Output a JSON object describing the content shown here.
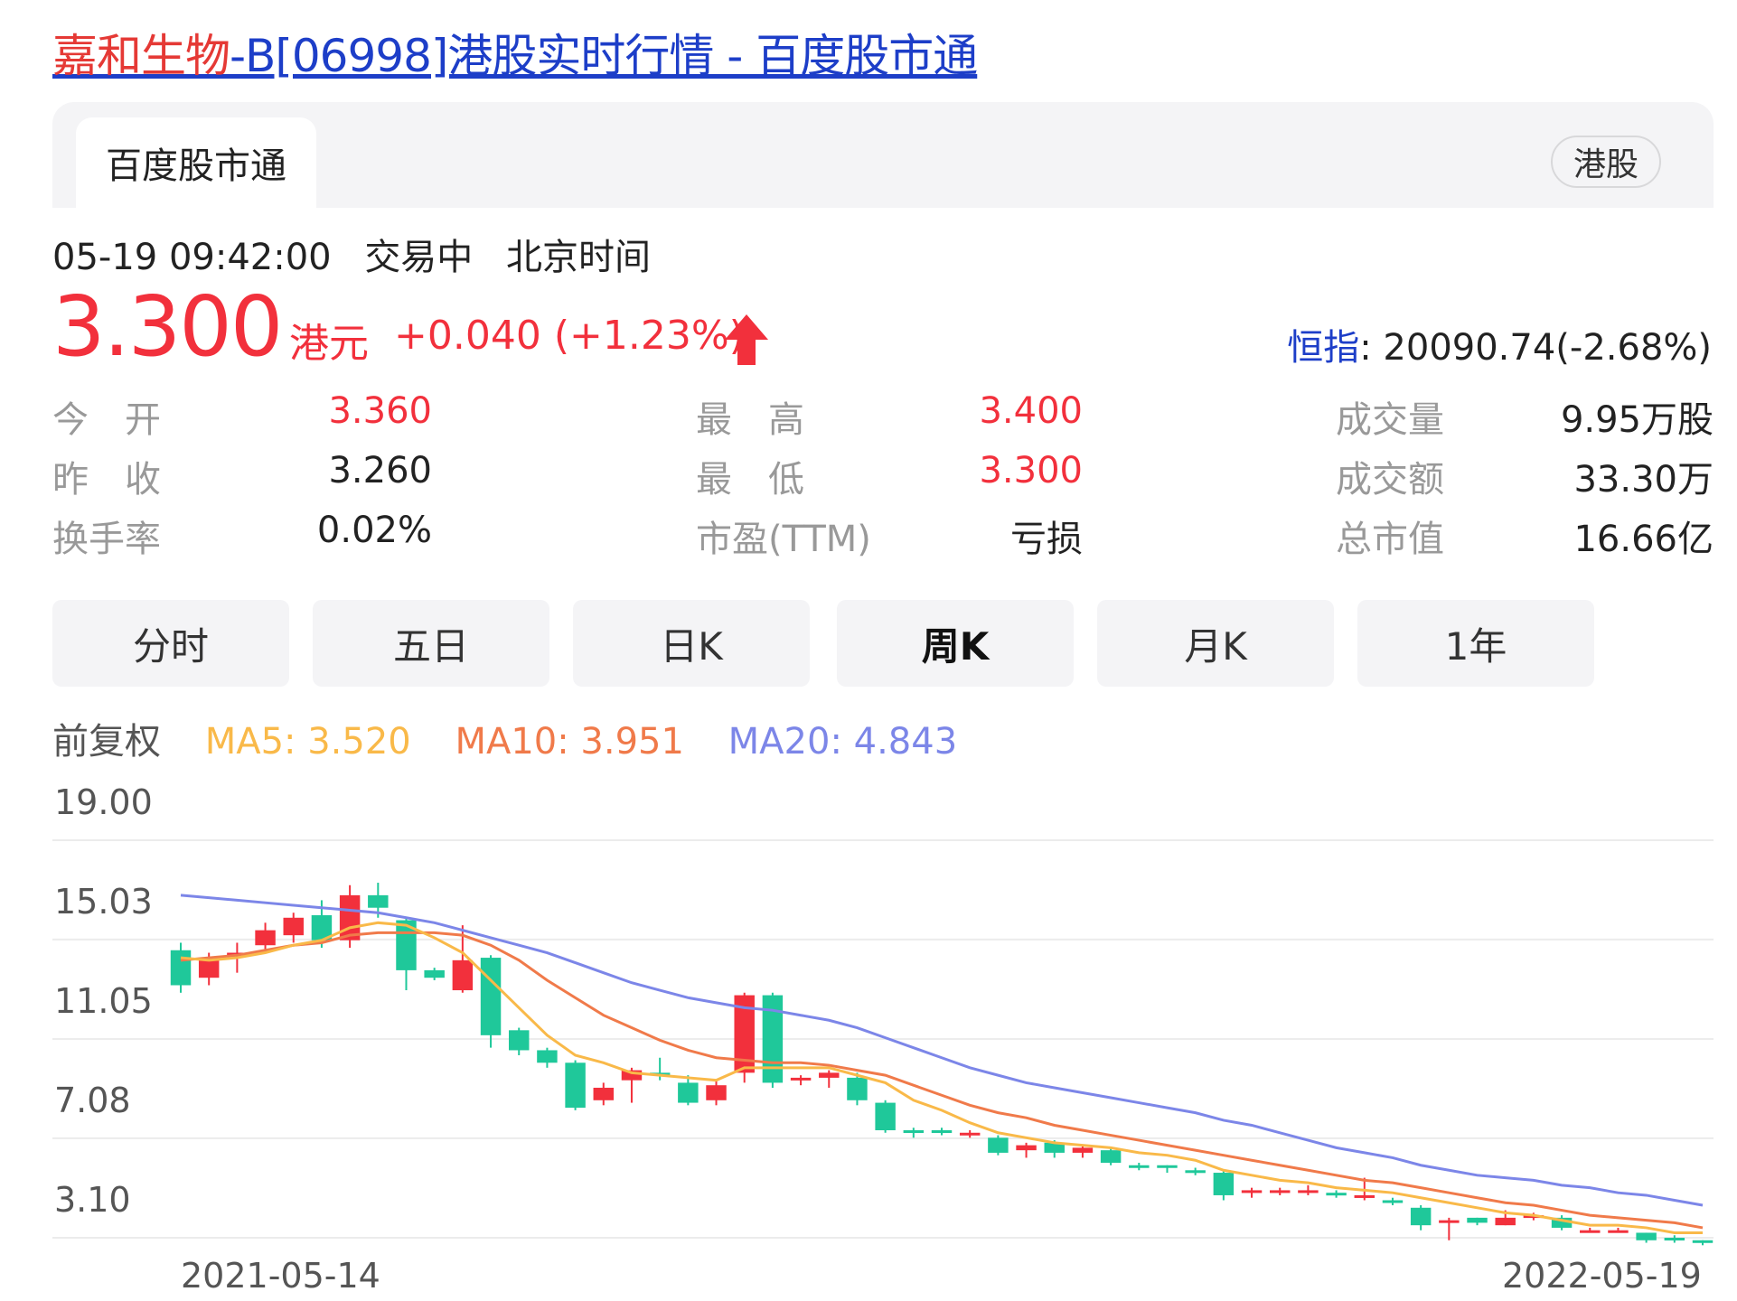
{
  "header": {
    "title_name": "嘉和生物",
    "title_rest": "-B[06998]港股实时行情 - 百度股市通"
  },
  "tabs": {
    "active_label": "百度股市通",
    "market_tag": "港股"
  },
  "status": {
    "datetime": "05-19 09:42:00",
    "trading_state": "交易中",
    "timezone": "北京时间"
  },
  "quote": {
    "price": "3.300",
    "currency": "港元",
    "change": "+0.040 (+1.23%)",
    "index_label": "恒指",
    "index_value": ": 20090.74(-2.68%)"
  },
  "stats": {
    "open_label": "今　开",
    "open_value": "3.360",
    "prev_close_label": "昨　收",
    "prev_close_value": "3.260",
    "turnover_rate_label": "换手率",
    "turnover_rate_value": "0.02%",
    "high_label": "最　高",
    "high_value": "3.400",
    "low_label": "最　低",
    "low_value": "3.300",
    "pe_label": "市盈(TTM)",
    "pe_value": "亏损",
    "volume_label": "成交量",
    "volume_value": "9.95万股",
    "amount_label": "成交额",
    "amount_value": "33.30万",
    "market_cap_label": "总市值",
    "market_cap_value": "16.66亿"
  },
  "periods": [
    "分时",
    "五日",
    "日K",
    "周K",
    "月K",
    "1年"
  ],
  "active_period": "周K",
  "ma": {
    "adjust_label": "前复权",
    "ma5": "MA5: 3.520",
    "ma10": "MA10: 3.951",
    "ma20": "MA20: 4.843"
  },
  "colors": {
    "up": "#f2303c",
    "down": "#1fc89a",
    "ma5": "#f9b949",
    "ma10": "#f07a4a",
    "ma20": "#7c86e8",
    "link": "#1d3ec8"
  },
  "chart_data": {
    "type": "candlestick",
    "y_ticks": [
      "19.00",
      "15.03",
      "11.05",
      "7.08",
      "3.10"
    ],
    "ylim": [
      3.1,
      19.0
    ],
    "x_labels": [
      "2021-05-14",
      "2022-05-19"
    ],
    "candles": [
      {
        "o": 14.6,
        "c": 13.2,
        "h": 14.9,
        "l": 12.9
      },
      {
        "o": 13.5,
        "c": 14.3,
        "h": 14.5,
        "l": 13.2
      },
      {
        "o": 14.4,
        "c": 14.5,
        "h": 14.9,
        "l": 13.7
      },
      {
        "o": 14.8,
        "c": 15.4,
        "h": 15.7,
        "l": 14.5
      },
      {
        "o": 15.2,
        "c": 15.9,
        "h": 16.1,
        "l": 14.9
      },
      {
        "o": 16.0,
        "c": 15.0,
        "h": 16.6,
        "l": 14.7
      },
      {
        "o": 15.0,
        "c": 16.8,
        "h": 17.2,
        "l": 14.7
      },
      {
        "o": 16.8,
        "c": 16.3,
        "h": 17.3,
        "l": 15.9
      },
      {
        "o": 15.8,
        "c": 13.8,
        "h": 15.9,
        "l": 13.0
      },
      {
        "o": 13.8,
        "c": 13.5,
        "h": 13.9,
        "l": 13.4
      },
      {
        "o": 13.0,
        "c": 14.2,
        "h": 15.6,
        "l": 12.9
      },
      {
        "o": 14.3,
        "c": 11.2,
        "h": 14.4,
        "l": 10.7
      },
      {
        "o": 11.4,
        "c": 10.6,
        "h": 11.5,
        "l": 10.4
      },
      {
        "o": 10.6,
        "c": 10.1,
        "h": 10.7,
        "l": 9.9
      },
      {
        "o": 10.1,
        "c": 8.3,
        "h": 10.2,
        "l": 8.2
      },
      {
        "o": 8.6,
        "c": 9.1,
        "h": 9.3,
        "l": 8.4
      },
      {
        "o": 9.4,
        "c": 9.8,
        "h": 9.9,
        "l": 8.5
      },
      {
        "o": 9.7,
        "c": 9.6,
        "h": 10.3,
        "l": 9.4
      },
      {
        "o": 9.3,
        "c": 8.5,
        "h": 9.6,
        "l": 8.4
      },
      {
        "o": 8.6,
        "c": 9.2,
        "h": 9.4,
        "l": 8.4
      },
      {
        "o": 9.7,
        "c": 12.8,
        "h": 12.9,
        "l": 9.3
      },
      {
        "o": 12.8,
        "c": 9.3,
        "h": 12.9,
        "l": 9.1
      },
      {
        "o": 9.4,
        "c": 9.5,
        "h": 9.6,
        "l": 9.2
      },
      {
        "o": 9.5,
        "c": 9.7,
        "h": 9.8,
        "l": 9.1
      },
      {
        "o": 9.5,
        "c": 8.6,
        "h": 9.7,
        "l": 8.4
      },
      {
        "o": 8.5,
        "c": 7.4,
        "h": 8.6,
        "l": 7.3
      },
      {
        "o": 7.4,
        "c": 7.3,
        "h": 7.5,
        "l": 7.1
      },
      {
        "o": 7.4,
        "c": 7.3,
        "h": 7.5,
        "l": 7.2
      },
      {
        "o": 7.2,
        "c": 7.3,
        "h": 7.4,
        "l": 7.1
      },
      {
        "o": 7.1,
        "c": 6.5,
        "h": 7.2,
        "l": 6.4
      },
      {
        "o": 6.6,
        "c": 6.8,
        "h": 6.9,
        "l": 6.3
      },
      {
        "o": 6.9,
        "c": 6.5,
        "h": 7.0,
        "l": 6.3
      },
      {
        "o": 6.5,
        "c": 6.7,
        "h": 6.8,
        "l": 6.3
      },
      {
        "o": 6.6,
        "c": 6.1,
        "h": 6.7,
        "l": 6.0
      },
      {
        "o": 6.0,
        "c": 5.9,
        "h": 6.1,
        "l": 5.8
      },
      {
        "o": 6.0,
        "c": 5.9,
        "h": 6.0,
        "l": 5.7
      },
      {
        "o": 5.8,
        "c": 5.7,
        "h": 5.9,
        "l": 5.6
      },
      {
        "o": 5.7,
        "c": 4.8,
        "h": 5.8,
        "l": 4.6
      },
      {
        "o": 4.9,
        "c": 5.0,
        "h": 5.1,
        "l": 4.7
      },
      {
        "o": 5.0,
        "c": 5.0,
        "h": 5.1,
        "l": 4.8
      },
      {
        "o": 4.9,
        "c": 5.0,
        "h": 5.2,
        "l": 4.8
      },
      {
        "o": 4.9,
        "c": 4.8,
        "h": 5.0,
        "l": 4.7
      },
      {
        "o": 4.8,
        "c": 4.8,
        "h": 5.5,
        "l": 4.6
      },
      {
        "o": 4.6,
        "c": 4.5,
        "h": 4.7,
        "l": 4.4
      },
      {
        "o": 4.3,
        "c": 3.6,
        "h": 4.4,
        "l": 3.4
      },
      {
        "o": 3.8,
        "c": 3.8,
        "h": 3.9,
        "l": 3.0
      },
      {
        "o": 3.9,
        "c": 3.7,
        "h": 3.9,
        "l": 3.6
      },
      {
        "o": 3.6,
        "c": 3.9,
        "h": 4.2,
        "l": 3.6
      },
      {
        "o": 3.9,
        "c": 4.0,
        "h": 4.1,
        "l": 3.8
      },
      {
        "o": 3.9,
        "c": 3.5,
        "h": 4.0,
        "l": 3.4
      },
      {
        "o": 3.4,
        "c": 3.4,
        "h": 3.5,
        "l": 3.3
      },
      {
        "o": 3.4,
        "c": 3.4,
        "h": 3.5,
        "l": 3.3
      },
      {
        "o": 3.3,
        "c": 3.0,
        "h": 3.3,
        "l": 2.9
      },
      {
        "o": 3.1,
        "c": 3.0,
        "h": 3.2,
        "l": 2.9
      },
      {
        "o": 3.0,
        "c": 2.9,
        "h": 3.0,
        "l": 2.8
      }
    ],
    "ma5": [
      14.3,
      14.2,
      14.3,
      14.5,
      14.8,
      15.0,
      15.5,
      15.7,
      15.6,
      15.1,
      14.5,
      13.4,
      12.3,
      11.2,
      10.4,
      10.1,
      9.7,
      9.6,
      9.5,
      9.4,
      9.9,
      9.9,
      9.9,
      9.9,
      9.6,
      9.3,
      8.6,
      8.2,
      7.7,
      7.3,
      7.1,
      6.9,
      6.8,
      6.7,
      6.5,
      6.4,
      6.2,
      5.8,
      5.6,
      5.4,
      5.3,
      5.1,
      5.0,
      4.9,
      4.7,
      4.5,
      4.3,
      4.1,
      4.0,
      3.8,
      3.6,
      3.6,
      3.5,
      3.3,
      3.3
    ],
    "ma10": [
      14.2,
      14.3,
      14.4,
      14.6,
      14.8,
      14.9,
      15.2,
      15.3,
      15.3,
      15.3,
      15.2,
      14.8,
      14.2,
      13.4,
      12.7,
      12.0,
      11.5,
      11.0,
      10.6,
      10.3,
      10.2,
      10.1,
      10.1,
      10.0,
      9.8,
      9.6,
      9.2,
      8.8,
      8.4,
      8.1,
      7.9,
      7.6,
      7.4,
      7.2,
      7.0,
      6.8,
      6.6,
      6.4,
      6.2,
      6.0,
      5.8,
      5.6,
      5.4,
      5.3,
      5.1,
      4.9,
      4.7,
      4.5,
      4.4,
      4.2,
      4.0,
      3.9,
      3.8,
      3.7,
      3.5
    ],
    "ma20": [
      16.8,
      16.7,
      16.6,
      16.5,
      16.4,
      16.3,
      16.2,
      16.1,
      15.9,
      15.7,
      15.4,
      15.1,
      14.8,
      14.5,
      14.1,
      13.7,
      13.3,
      13.0,
      12.7,
      12.5,
      12.3,
      12.2,
      12.0,
      11.8,
      11.5,
      11.1,
      10.7,
      10.3,
      9.9,
      9.6,
      9.3,
      9.1,
      8.9,
      8.7,
      8.5,
      8.3,
      8.1,
      7.8,
      7.6,
      7.3,
      7.0,
      6.7,
      6.5,
      6.3,
      6.0,
      5.8,
      5.6,
      5.5,
      5.4,
      5.2,
      5.1,
      4.9,
      4.8,
      4.6,
      4.4
    ]
  }
}
